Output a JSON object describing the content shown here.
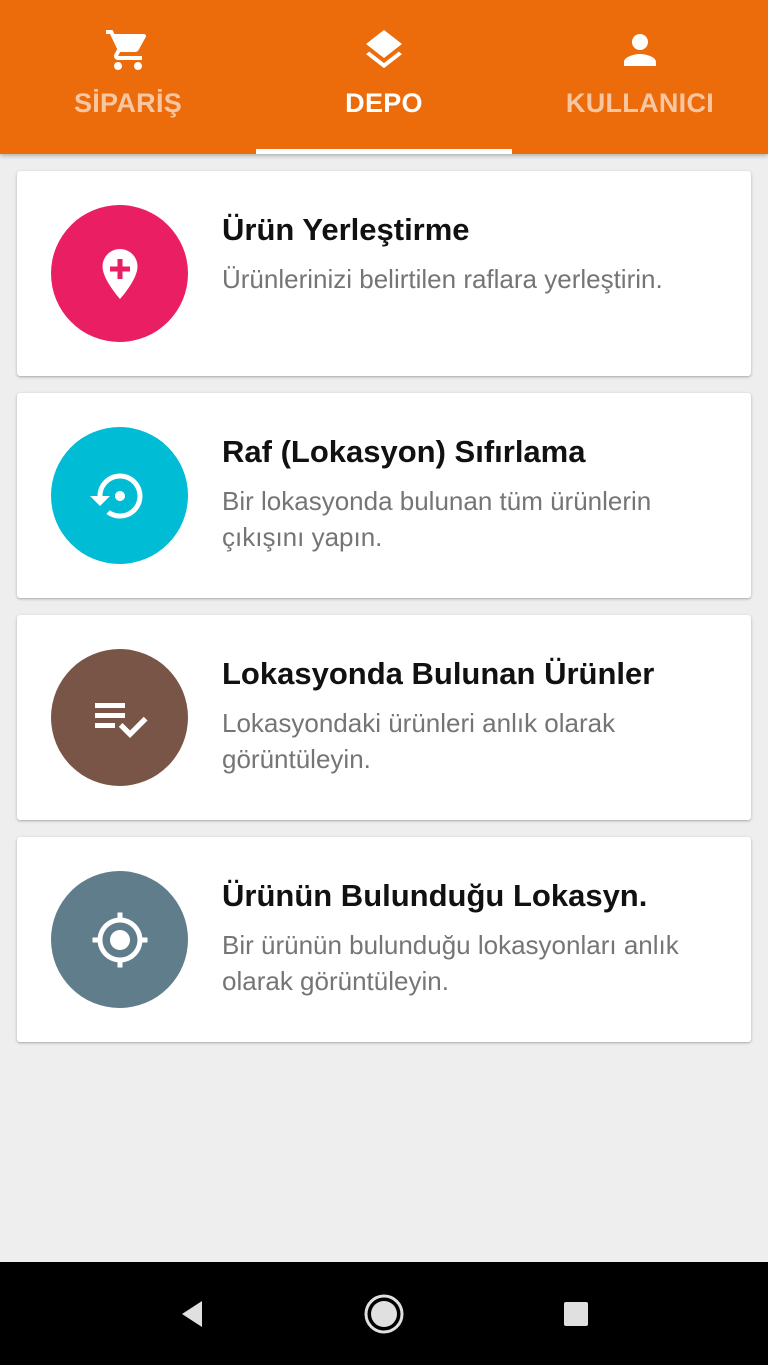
{
  "tabs": [
    {
      "label": "SİPARİŞ",
      "icon": "cart-icon",
      "active": false
    },
    {
      "label": "DEPO",
      "icon": "layers-icon",
      "active": true
    },
    {
      "label": "KULLANICI",
      "icon": "person-icon",
      "active": false
    }
  ],
  "cards": [
    {
      "title": "Ürün Yerleştirme",
      "description": "Ürünlerinizi belirtilen raflara yerleştirin.",
      "icon": "add-location-icon",
      "color": "#e91e63"
    },
    {
      "title": "Raf (Lokasyon) Sıfırlama",
      "description": "Bir lokasyonda bulunan tüm ürünlerin çıkışını yapın.",
      "icon": "restore-icon",
      "color": "#00bcd4"
    },
    {
      "title": "Lokasyonda Bulunan Ürünler",
      "description": "Lokasyondaki ürünleri anlık olarak görüntüleyin.",
      "icon": "playlist-check-icon",
      "color": "#795548"
    },
    {
      "title": "Ürünün Bulunduğu Lokasyn.",
      "description": "Bir ürünün bulunduğu lokasyonları anlık olarak görüntüleyin.",
      "icon": "gps-target-icon",
      "color": "#607d8b"
    }
  ],
  "theme": {
    "primary": "#ec6b0a",
    "background": "#eeeeee",
    "navbar": "#000000"
  },
  "navbar": {
    "back_icon": "back-triangle-icon",
    "home_icon": "home-circle-icon",
    "recent_icon": "recents-square-icon"
  }
}
